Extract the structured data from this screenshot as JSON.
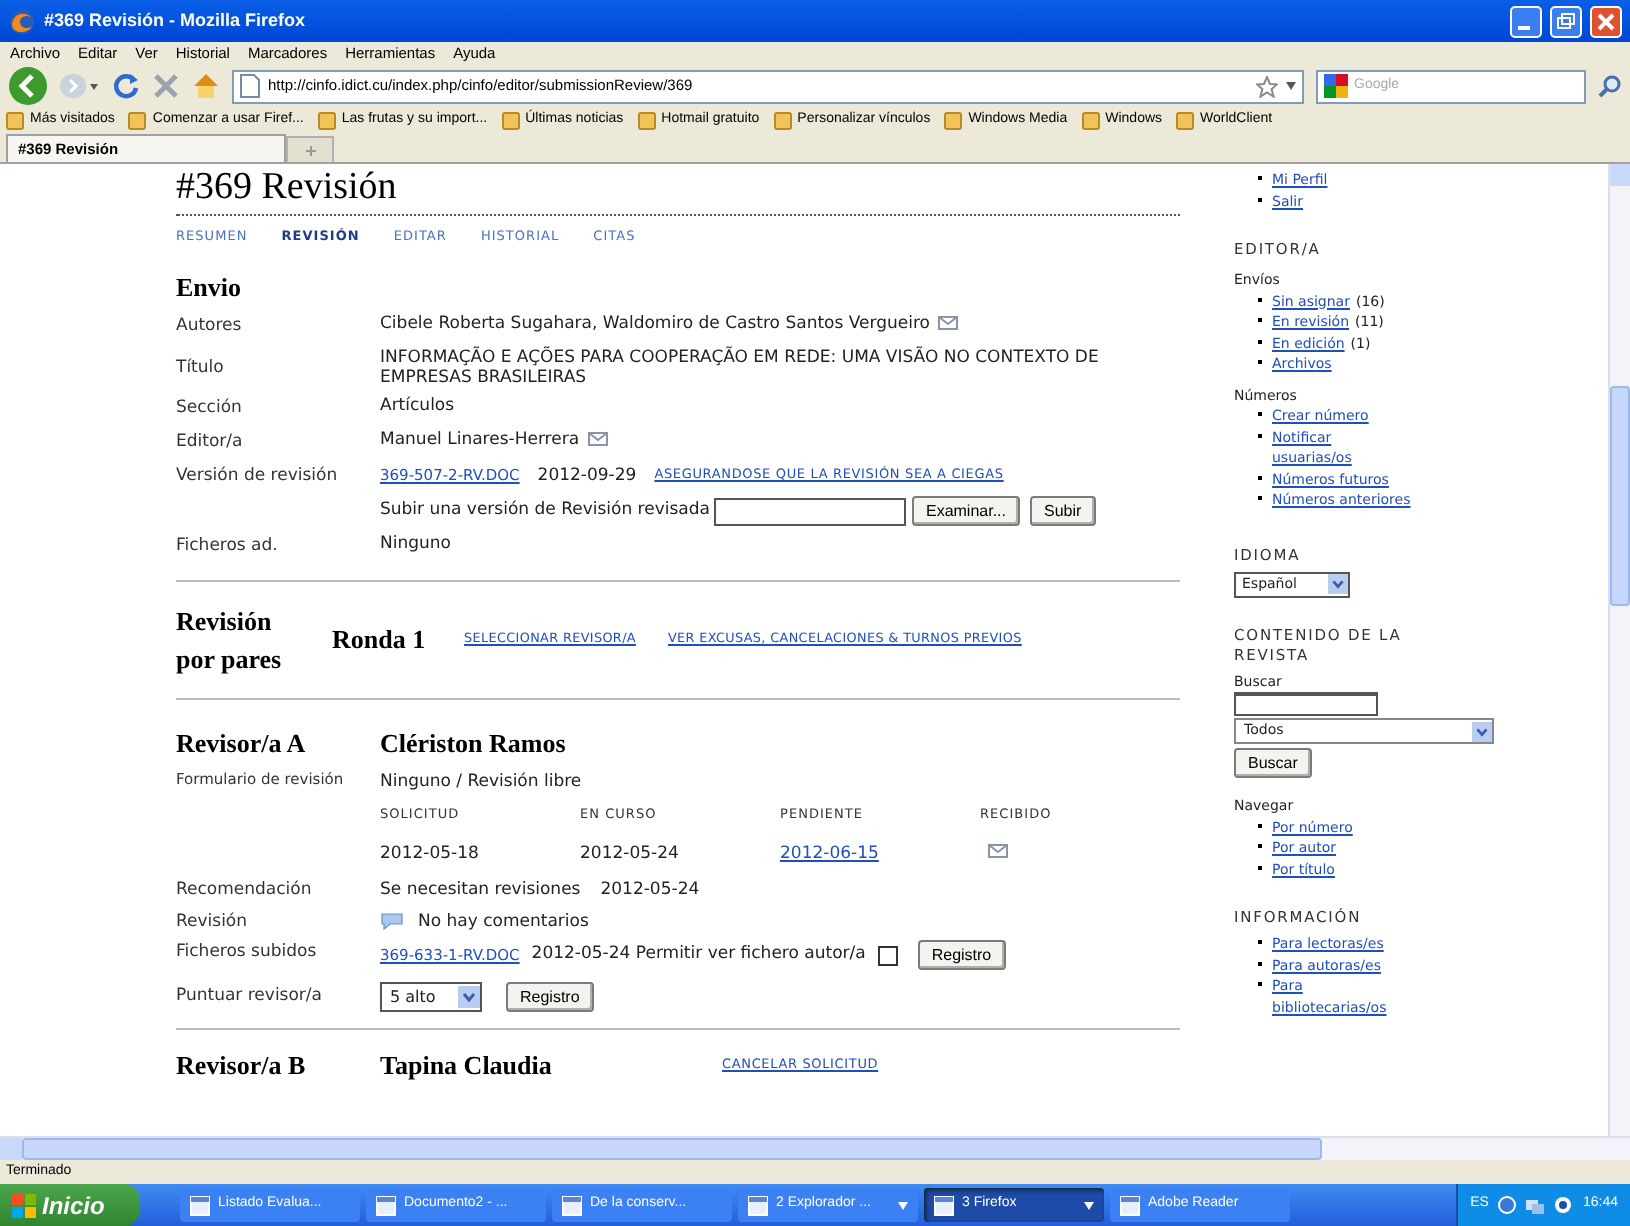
{
  "window": {
    "title": "#369 Revisión - Mozilla Firefox"
  },
  "menu": [
    "Archivo",
    "Editar",
    "Ver",
    "Historial",
    "Marcadores",
    "Herramientas",
    "Ayuda"
  ],
  "toolbar": {
    "url": "http://cinfo.idict.cu/index.php/cinfo/editor/submissionReview/369",
    "search_placeholder": "Google"
  },
  "bookmarks": [
    "Más visitados",
    "Comenzar a usar Firef...",
    "Las frutas y su import...",
    "Últimas noticias",
    "Hotmail gratuito",
    "Personalizar vínculos",
    "Windows Media",
    "Windows",
    "WorldClient"
  ],
  "tabs": [
    {
      "label": "#369 Revisión",
      "selected": true
    }
  ],
  "page": {
    "heading": "#369 Revisión",
    "nav": [
      {
        "label": "RESUMEN",
        "selected": false
      },
      {
        "label": "REVISIÓN",
        "selected": true
      },
      {
        "label": "EDITAR",
        "selected": false
      },
      {
        "label": "HISTORIAL",
        "selected": false
      },
      {
        "label": "CITAS",
        "selected": false
      }
    ],
    "submission": {
      "heading": "Envio",
      "rows": [
        {
          "kind": "text",
          "label": "Autores",
          "value": "Cibele Roberta Sugahara, Waldomiro de Castro Santos Vergueiro",
          "mail": true
        },
        {
          "kind": "text",
          "label": "Título",
          "value": "INFORMAÇÃO E AÇÕES PARA COOPERAÇÃO EM REDE: UMA VISÃO NO CONTEXTO DE EMPRESAS BRASILEIRAS",
          "mail": false
        },
        {
          "kind": "text",
          "label": "Sección",
          "value": "Artículos",
          "mail": false
        },
        {
          "kind": "text",
          "label": "Editor/a",
          "value": "Manuel Linares-Herrera",
          "mail": true
        },
        {
          "kind": "file",
          "label": "Versión de revisión",
          "file": "369-507-2-RV.DOC",
          "date": "2012-09-29",
          "link": "ASEGURANDOSE QUE LA REVISIÓN SEA A CIEGAS"
        },
        {
          "kind": "upload",
          "text": "Subir una versión de Revisión revisada",
          "browse": "Examinar...",
          "submit": "Subir"
        },
        {
          "kind": "text",
          "label": "Ficheros ad.",
          "value": "Ninguno",
          "mail": false
        }
      ]
    },
    "peer_review": {
      "heading": "Revisión por pares",
      "round": "Ronda 1",
      "links": [
        "SELECCIONAR REVISOR/A",
        "VER EXCUSAS, CANCELACIONES & TURNOS PREVIOS"
      ]
    },
    "reviewers": [
      {
        "heading": "Revisor/a A",
        "name": "Clériston Ramos",
        "form": {
          "label": "Formulario de revisión",
          "value": "Ninguno / Revisión libre"
        },
        "dates": {
          "columns": [
            "SOLICITUD",
            "EN CURSO",
            "PENDIENTE",
            "RECIBIDO"
          ],
          "values": [
            {
              "kind": "text",
              "text": "2012-05-18"
            },
            {
              "kind": "text",
              "text": "2012-05-24"
            },
            {
              "kind": "link",
              "text": "2012-06-15"
            },
            {
              "kind": "icon"
            }
          ]
        },
        "recommendation": {
          "label": "Recomendación",
          "value": "Se necesitan revisiones",
          "date": "2012-05-24"
        },
        "review": {
          "label": "Revisión",
          "value": "No hay comentarios"
        },
        "files": {
          "label": "Ficheros subidos",
          "file": "369-633-1-RV.DOC",
          "text": "2012-05-24 Permitir ver fichero autor/a",
          "checked": false,
          "button": "Registro"
        },
        "rating": {
          "label": "Puntuar revisor/a",
          "value": "5 alto",
          "button": "Registro"
        }
      },
      {
        "heading": "Revisor/a B",
        "name": "Tapina Claudia",
        "link": "CANCELAR SOLICITUD"
      }
    ]
  },
  "sidebar": {
    "user_links": [
      "Mi Perfil",
      "Salir"
    ],
    "editor": {
      "title": "EDITOR/A",
      "groups": [
        {
          "title": "Envíos",
          "items": [
            {
              "link": "Sin asignar",
              "count": "(16)"
            },
            {
              "link": "En revisión",
              "count": "(11)"
            },
            {
              "link": "En edición",
              "count": "(1)"
            },
            {
              "link": "Archivos"
            }
          ]
        },
        {
          "title": "Números",
          "items": [
            {
              "link": "Crear número"
            },
            {
              "link": "Notificar usuarias/os"
            },
            {
              "link": "Números futuros"
            },
            {
              "link": "Números anteriores"
            }
          ]
        }
      ]
    },
    "language": {
      "title": "IDIOMA",
      "value": "Español"
    },
    "content": {
      "title": "CONTENIDO DE LA REVISTA",
      "search_label": "Buscar",
      "scope": "Todos",
      "button": "Buscar",
      "browse_label": "Navegar",
      "browse": [
        "Por número",
        "Por autor",
        "Por título"
      ]
    },
    "info": {
      "title": "INFORMACIÓN",
      "links": [
        "Para lectoras/es",
        "Para autoras/es",
        "Para bibliotecarias/os"
      ]
    }
  },
  "status_bar": "Terminado",
  "taskbar": {
    "start": "Inicio",
    "items": [
      {
        "label": "Listado Evalua...",
        "selected": false,
        "menu": false
      },
      {
        "label": "Documento2 - ...",
        "selected": false,
        "menu": false
      },
      {
        "label": "De la conserv...",
        "selected": false,
        "menu": false
      },
      {
        "label": "2 Explorador ...",
        "selected": false,
        "menu": true
      },
      {
        "label": "3 Firefox",
        "selected": true,
        "menu": true
      },
      {
        "label": "Adobe Reader",
        "selected": false,
        "menu": false
      }
    ],
    "language": "ES",
    "clock": "16:44"
  }
}
